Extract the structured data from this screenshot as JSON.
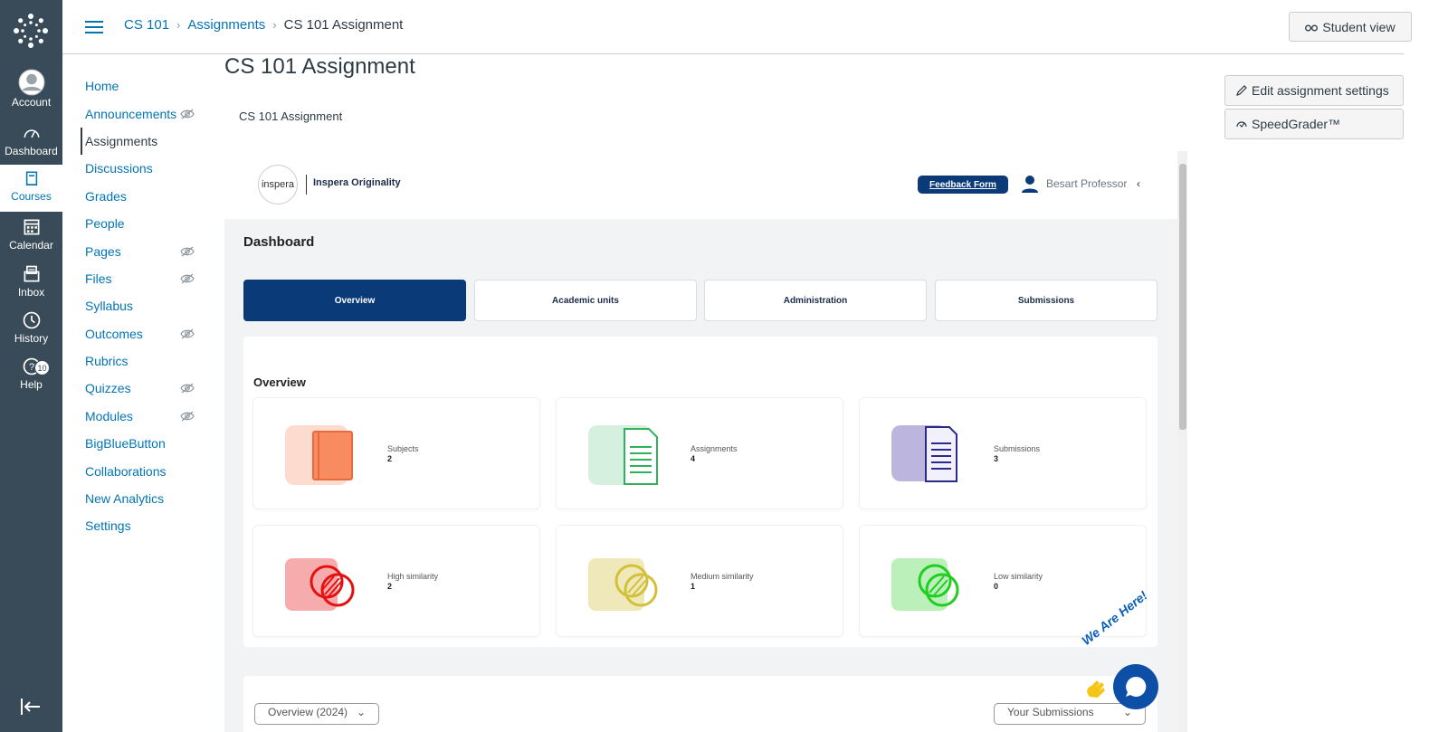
{
  "global_nav": {
    "items": [
      {
        "label": "Account",
        "icon": "avatar-icon"
      },
      {
        "label": "Dashboard",
        "icon": "dashboard-icon"
      },
      {
        "label": "Courses",
        "icon": "book-icon"
      },
      {
        "label": "Calendar",
        "icon": "calendar-icon"
      },
      {
        "label": "Inbox",
        "icon": "inbox-icon"
      },
      {
        "label": "History",
        "icon": "clock-icon"
      },
      {
        "label": "Help",
        "icon": "help-icon",
        "badge": "10"
      }
    ]
  },
  "header": {
    "breadcrumbs": [
      "CS 101",
      "Assignments",
      "CS 101 Assignment"
    ],
    "student_view_label": "Student view"
  },
  "course_nav": {
    "items": [
      {
        "label": "Home",
        "hidden": false
      },
      {
        "label": "Announcements",
        "hidden": true
      },
      {
        "label": "Assignments",
        "hidden": false,
        "active": true
      },
      {
        "label": "Discussions",
        "hidden": false
      },
      {
        "label": "Grades",
        "hidden": false
      },
      {
        "label": "People",
        "hidden": false
      },
      {
        "label": "Pages",
        "hidden": true
      },
      {
        "label": "Files",
        "hidden": true
      },
      {
        "label": "Syllabus",
        "hidden": false
      },
      {
        "label": "Outcomes",
        "hidden": true
      },
      {
        "label": "Rubrics",
        "hidden": false
      },
      {
        "label": "Quizzes",
        "hidden": true
      },
      {
        "label": "Modules",
        "hidden": true
      },
      {
        "label": "BigBlueButton",
        "hidden": false
      },
      {
        "label": "Collaborations",
        "hidden": false
      },
      {
        "label": "New Analytics",
        "hidden": false
      },
      {
        "label": "Settings",
        "hidden": false
      }
    ]
  },
  "main": {
    "title": "CS 101 Assignment",
    "subtitle": "CS 101 Assignment"
  },
  "right_actions": {
    "edit_label": "Edit assignment settings",
    "speedgrader_label": "SpeedGrader™"
  },
  "inspera": {
    "logo_text": "inspera",
    "product_name": "Inspera Originality",
    "feedback_label": "Feedback Form",
    "user_name": "Besart Professor",
    "dashboard_title": "Dashboard",
    "tabs": [
      "Overview",
      "Academic units",
      "Administration",
      "Submissions"
    ],
    "overview_title": "Overview",
    "cards": [
      {
        "label": "Subjects",
        "value": "2",
        "color": "#f98b60"
      },
      {
        "label": "Assignments",
        "value": "4",
        "color": "#2eb35a"
      },
      {
        "label": "Submissions",
        "value": "3",
        "color": "#2a2a8f"
      },
      {
        "label": "High similarity",
        "value": "2",
        "color": "#e61010"
      },
      {
        "label": "Medium similarity",
        "value": "1",
        "color": "#d2c03a"
      },
      {
        "label": "Low similarity",
        "value": "0",
        "color": "#1fce1f"
      }
    ],
    "filter_left": "Overview (2024)",
    "filter_right": "Your Submissions"
  },
  "chat": {
    "tagline": "We Are Here!"
  }
}
